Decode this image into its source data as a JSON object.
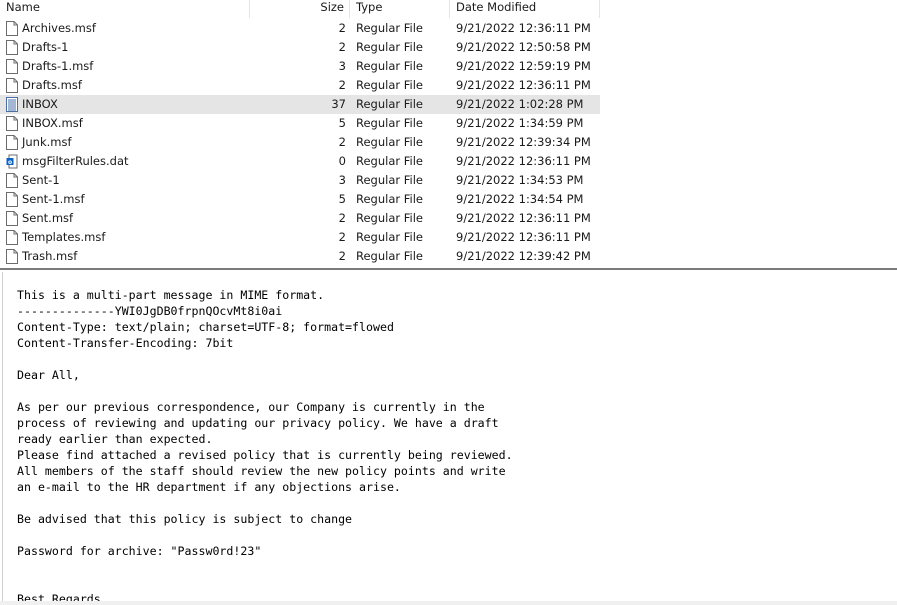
{
  "file_list": {
    "columns": {
      "name": "Name",
      "size": "Size",
      "type": "Type",
      "date": "Date Modified"
    },
    "rows": [
      {
        "name": "Archives.msf",
        "size": "2",
        "type": "Regular File",
        "date": "9/21/2022 12:36:11 PM",
        "icon": "file-icon"
      },
      {
        "name": "Drafts-1",
        "size": "2",
        "type": "Regular File",
        "date": "9/21/2022 12:50:58 PM",
        "icon": "file-icon"
      },
      {
        "name": "Drafts-1.msf",
        "size": "3",
        "type": "Regular File",
        "date": "9/21/2022 12:59:19 PM",
        "icon": "file-icon"
      },
      {
        "name": "Drafts.msf",
        "size": "2",
        "type": "Regular File",
        "date": "9/21/2022 12:36:11 PM",
        "icon": "file-icon"
      },
      {
        "name": "INBOX",
        "size": "37",
        "type": "Regular File",
        "date": "9/21/2022 1:02:28 PM",
        "icon": "text-file-icon",
        "selected": true
      },
      {
        "name": "INBOX.msf",
        "size": "5",
        "type": "Regular File",
        "date": "9/21/2022 1:34:59 PM",
        "icon": "file-icon"
      },
      {
        "name": "Junk.msf",
        "size": "2",
        "type": "Regular File",
        "date": "9/21/2022 12:39:34 PM",
        "icon": "file-icon"
      },
      {
        "name": "msgFilterRules.dat",
        "size": "0",
        "type": "Regular File",
        "date": "9/21/2022 12:36:11 PM",
        "icon": "outlook-data-icon"
      },
      {
        "name": "Sent-1",
        "size": "3",
        "type": "Regular File",
        "date": "9/21/2022 1:34:53 PM",
        "icon": "file-icon"
      },
      {
        "name": "Sent-1.msf",
        "size": "5",
        "type": "Regular File",
        "date": "9/21/2022 1:34:54 PM",
        "icon": "file-icon"
      },
      {
        "name": "Sent.msf",
        "size": "2",
        "type": "Regular File",
        "date": "9/21/2022 12:36:11 PM",
        "icon": "file-icon"
      },
      {
        "name": "Templates.msf",
        "size": "2",
        "type": "Regular File",
        "date": "9/21/2022 12:36:11 PM",
        "icon": "file-icon"
      },
      {
        "name": "Trash.msf",
        "size": "2",
        "type": "Regular File",
        "date": "9/21/2022 12:39:42 PM",
        "icon": "file-icon"
      }
    ]
  },
  "viewer": {
    "content": "This is a multi-part message in MIME format.\n--------------YWI0JgDB0frpnQOcvMt8i0ai\nContent-Type: text/plain; charset=UTF-8; format=flowed\nContent-Transfer-Encoding: 7bit\n\nDear All,\n\nAs per our previous correspondence, our Company is currently in the\nprocess of reviewing and updating our privacy policy. We have a draft\nready earlier than expected.\nPlease find attached a revised policy that is currently being reviewed.\nAll members of the staff should review the new policy points and write\nan e-mail to the HR department if any objections arise.\n\nBe advised that this policy is subject to change\n\nPassword for archive: \"Passw0rd!23\"\n\n\nBest Regards,"
  },
  "colors": {
    "selected_row": "#e5e5e5",
    "splitter": "#7a7a7a",
    "text": "#1a1a1a"
  }
}
